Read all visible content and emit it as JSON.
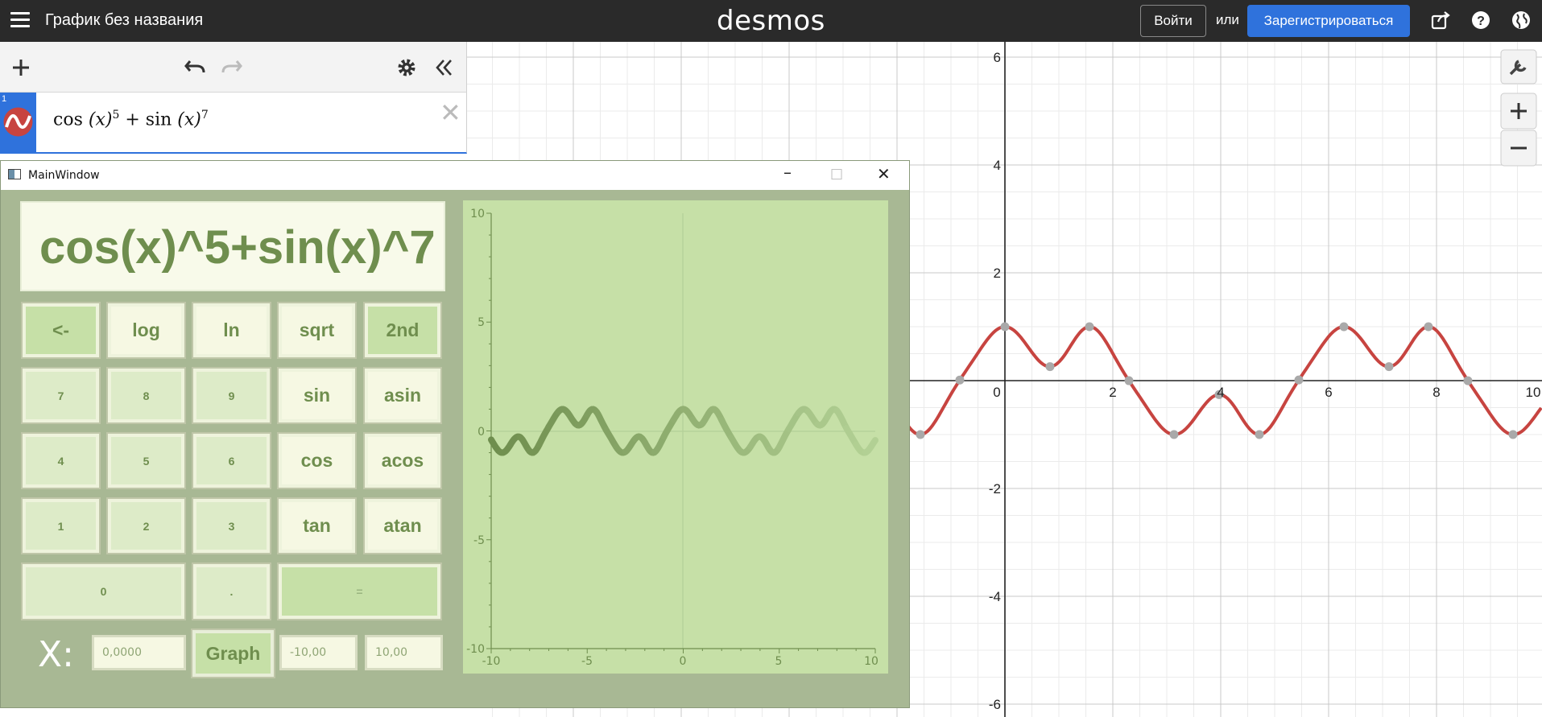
{
  "desmos": {
    "graph_title": "График без названия",
    "logo": "desmos",
    "login_label": "Войти",
    "or_label": "или",
    "signup_label": "Зарегистрироваться",
    "expression": {
      "index": "1",
      "latex_parts": [
        "cos",
        "(x)",
        "5",
        " + sin",
        "(x)",
        "7"
      ]
    },
    "x_ticks": [
      "0",
      "2",
      "4",
      "6",
      "8",
      "10"
    ],
    "y_ticks": [
      "6",
      "4",
      "2",
      "-2",
      "-4",
      "-6"
    ],
    "curve_color": "#c74440",
    "accent_color": "#2f72dc"
  },
  "mainwindow": {
    "title": "MainWindow",
    "display_text": "cos(x)^5+sin(x)^7",
    "keys": [
      "<-",
      "log",
      "ln",
      "sqrt",
      "2nd",
      "7",
      "8",
      "9",
      "sin",
      "asin",
      "4",
      "5",
      "6",
      "cos",
      "acos",
      "1",
      "2",
      "3",
      "tan",
      "atan",
      "0",
      ".",
      "="
    ],
    "x_label": "X:",
    "x_value": "0,0000",
    "graph_label": "Graph",
    "range_min": "-10,00",
    "range_max": "10,00",
    "plot": {
      "x_ticks": [
        "-10",
        "-5",
        "0",
        "5",
        "10"
      ],
      "y_ticks": [
        "10",
        "5",
        "0",
        "-5",
        "-10"
      ]
    }
  },
  "chart_data": {
    "type": "line",
    "expression": "cos(x)^5+sin(x)^7",
    "xlim": [
      -10,
      10
    ],
    "ylim": [
      -10,
      10
    ]
  }
}
